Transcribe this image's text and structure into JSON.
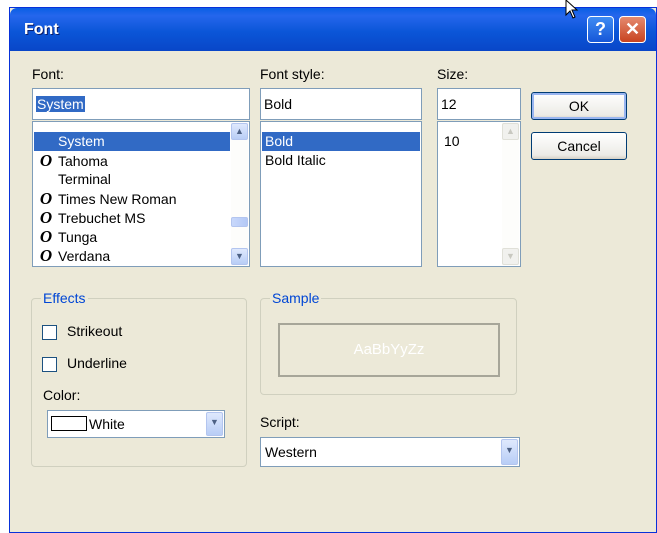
{
  "window": {
    "title": "Font"
  },
  "titlebar": {
    "help_glyph": "?",
    "close_glyph": "✕"
  },
  "font": {
    "label": "Font:",
    "value": "System",
    "items": [
      {
        "name": "System",
        "icon": ""
      },
      {
        "name": "Tahoma",
        "icon": "O"
      },
      {
        "name": "Terminal",
        "icon": ""
      },
      {
        "name": "Times New Roman",
        "icon": "O"
      },
      {
        "name": "Trebuchet MS",
        "icon": "O"
      },
      {
        "name": "Tunga",
        "icon": "O"
      },
      {
        "name": "Verdana",
        "icon": "O"
      }
    ],
    "selected": "System"
  },
  "style": {
    "label": "Font style:",
    "value": "Bold",
    "items": [
      "Bold",
      "Bold Italic"
    ],
    "selected": "Bold"
  },
  "size": {
    "label": "Size:",
    "value": "12",
    "items": [
      "10"
    ]
  },
  "buttons": {
    "ok": "OK",
    "cancel": "Cancel"
  },
  "effects": {
    "title": "Effects",
    "strikeout": "Strikeout",
    "underline": "Underline",
    "color_label": "Color:",
    "color_value": "White",
    "color_swatch": "#ffffff"
  },
  "sample": {
    "title": "Sample",
    "text": "AaBbYyZz"
  },
  "script": {
    "label": "Script:",
    "value": "Western"
  },
  "icons": {
    "scroll_up": "▲",
    "scroll_down": "▼",
    "dropdown": "▼",
    "font_type": "O"
  },
  "colors": {
    "selection": "#316ac5",
    "group_title": "#0046d5",
    "titlebar": "#0a5fe4"
  }
}
